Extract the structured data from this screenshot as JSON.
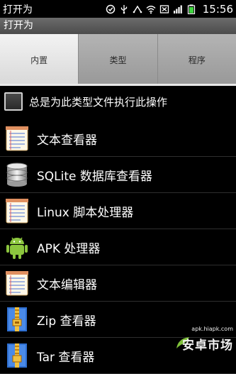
{
  "status_bar": {
    "notification_text": "打开为",
    "clock": "15:56",
    "icons": [
      "alarm-icon",
      "usb-icon",
      "usb-debug-icon",
      "wifi-icon",
      "sd-card-icon",
      "signal-icon",
      "battery-icon"
    ]
  },
  "title_bar": {
    "title": "打开为"
  },
  "tabs": [
    {
      "label": "内置",
      "selected": true
    },
    {
      "label": "类型",
      "selected": false
    },
    {
      "label": "程序",
      "selected": false
    }
  ],
  "always_option": {
    "label": "总是为此类型文件执行此操作",
    "checked": false
  },
  "list": [
    {
      "label": "文本查看器",
      "icon": "notepad-icon"
    },
    {
      "label": "SQLite 数据库查看器",
      "icon": "database-icon"
    },
    {
      "label": "Linux 脚本处理器",
      "icon": "notepad-icon"
    },
    {
      "label": "APK 处理器",
      "icon": "android-icon"
    },
    {
      "label": "文本编辑器",
      "icon": "notepad-icon"
    },
    {
      "label": "Zip 查看器",
      "icon": "zip-archive-icon"
    },
    {
      "label": "Tar 查看器",
      "icon": "zip-archive-icon"
    }
  ],
  "watermark": {
    "url": "apk.hiapk.com",
    "text": "安卓市场"
  }
}
